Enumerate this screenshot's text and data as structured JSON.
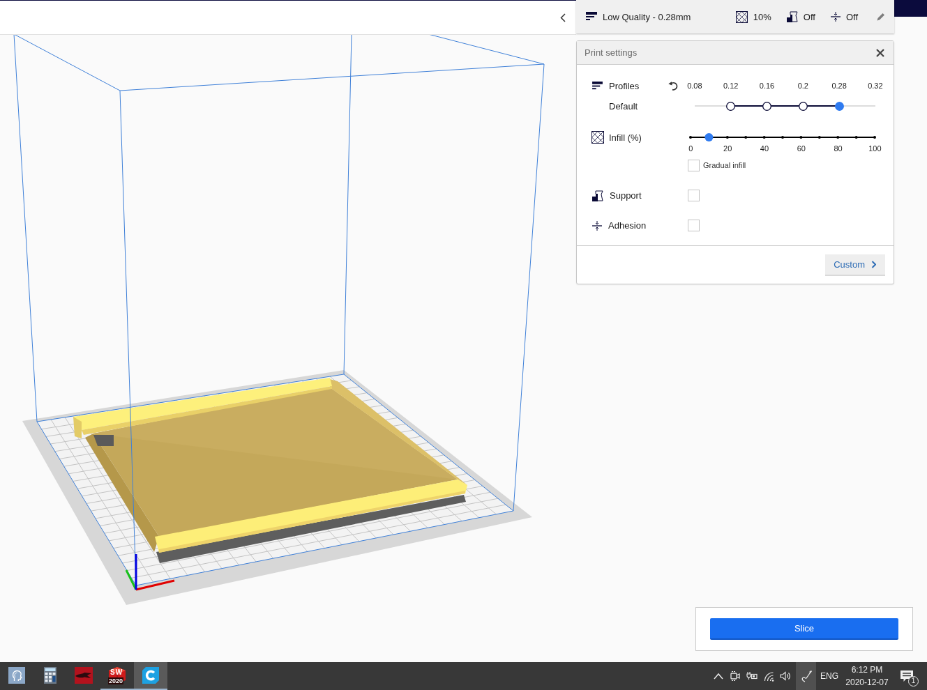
{
  "print_setup_bar": {
    "profile": "Low Quality - 0.28mm",
    "infill": "10%",
    "support": "Off",
    "adhesion": "Off"
  },
  "print_settings": {
    "title": "Print settings",
    "profiles": {
      "label": "Profiles",
      "current": "Default",
      "layer_heights": [
        {
          "label": "0.08",
          "available": false,
          "selected": false
        },
        {
          "label": "0.12",
          "available": true,
          "selected": false
        },
        {
          "label": "0.16",
          "available": true,
          "selected": false
        },
        {
          "label": "0.2",
          "available": true,
          "selected": false
        },
        {
          "label": "0.28",
          "available": true,
          "selected": true
        },
        {
          "label": "0.32",
          "available": false,
          "selected": false
        }
      ]
    },
    "infill": {
      "label": "Infill (%)",
      "level": 0.1,
      "scale": [
        "0",
        "20",
        "40",
        "60",
        "80",
        "100"
      ],
      "gradual": {
        "label": "Gradual infill",
        "checked": false
      }
    },
    "support": {
      "label": "Support",
      "checked": false
    },
    "adhesion": {
      "label": "Adhesion",
      "checked": false
    },
    "custom_button": "Custom"
  },
  "slice_panel": {
    "button": "Slice"
  },
  "taskbar": {
    "apps": [
      {
        "kind": "head",
        "running": false,
        "selected": false
      },
      {
        "kind": "calculator",
        "running": false,
        "selected": false
      },
      {
        "kind": "swoosh",
        "running": false,
        "selected": false
      },
      {
        "kind": "cube",
        "logo": "SW",
        "version": "2020",
        "running": true,
        "selected": false
      },
      {
        "kind": "ring",
        "running": true,
        "selected": true
      }
    ],
    "tray_icons": [
      {
        "kind": "chevron",
        "highlighted": false
      },
      {
        "kind": "camera",
        "highlighted": false
      },
      {
        "kind": "battery",
        "highlighted": false
      },
      {
        "kind": "wifi",
        "highlighted": false
      },
      {
        "kind": "speaker",
        "highlighted": false
      },
      {
        "kind": "pen",
        "highlighted": true
      }
    ],
    "language": "ENG",
    "time": "6:12 PM",
    "date": "2020-12-07",
    "notifications": "1"
  }
}
